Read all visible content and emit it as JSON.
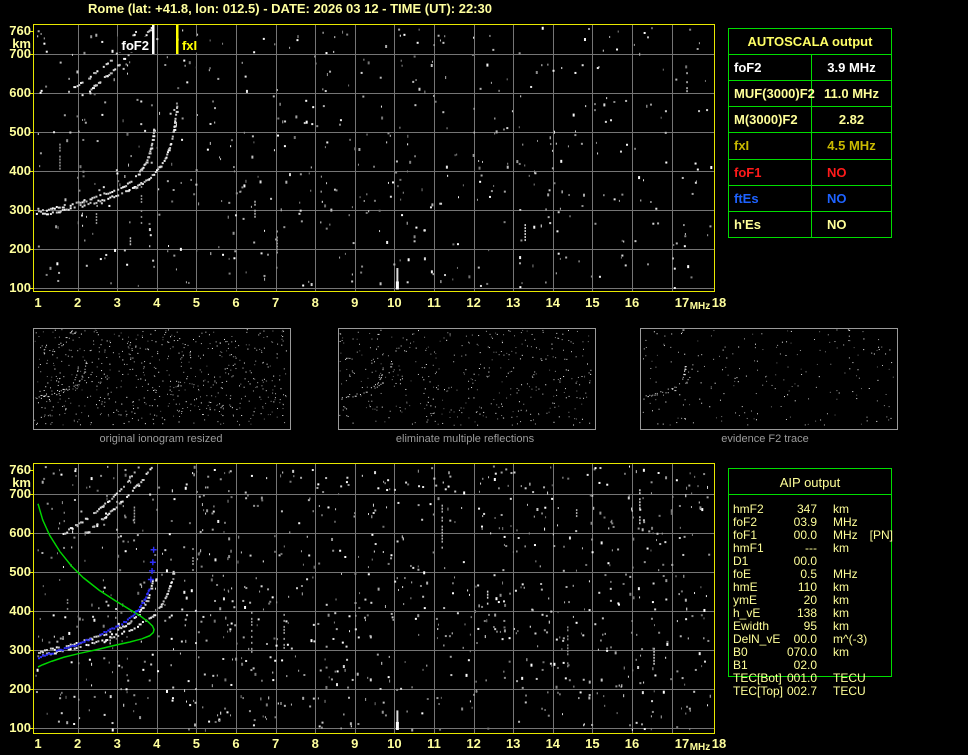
{
  "title": "Rome (lat: +41.8, lon: 012.5) - DATE: 2026 03 12 - TIME (UT): 22:30",
  "colors": {
    "background": "#000000",
    "axis_text": "#ffff9c",
    "plot_border": "#e8e800",
    "grid": "#757575",
    "table_border": "#00dd00",
    "trace_white": "#ffffff",
    "profile_green": "#00d400",
    "restored_blue": "#2e2eff",
    "caption_grey": "#9c9c9c"
  },
  "autoscala_table": {
    "header": "AUTOSCALA output",
    "rows": [
      {
        "label": "foF2",
        "value": "3.9 MHz",
        "color": "#ffffff"
      },
      {
        "label": "MUF(3000)F2",
        "value": "11.0 MHz",
        "color": "#ffff99"
      },
      {
        "label": "M(3000)F2",
        "value": "2.82",
        "color": "#ffff99"
      },
      {
        "label": "fxI",
        "value": "4.5 MHz",
        "color": "#c9b900"
      },
      {
        "label": "foF1",
        "value": "NO",
        "color": "#ff1a1a"
      },
      {
        "label": "ftEs",
        "value": "NO",
        "color": "#1e62ff"
      },
      {
        "label": "h'Es",
        "value": "NO",
        "color": "#ffff99"
      }
    ]
  },
  "aip_table": {
    "header": "AIP output",
    "rows": [
      {
        "label": "hmF2",
        "value": "347",
        "unit": "km",
        "extra": ""
      },
      {
        "label": "foF2",
        "value": "03.9",
        "unit": "MHz",
        "extra": ""
      },
      {
        "label": "foF1",
        "value": "00.0",
        "unit": "MHz",
        "extra": "[PN]"
      },
      {
        "label": "hmF1",
        "value": "---",
        "unit": "km",
        "extra": ""
      },
      {
        "label": "D1",
        "value": "00.0",
        "unit": "",
        "extra": ""
      },
      {
        "label": "foE",
        "value": "0.5",
        "unit": "MHz",
        "extra": ""
      },
      {
        "label": "hmE",
        "value": "110",
        "unit": "km",
        "extra": ""
      },
      {
        "label": "ymE",
        "value": "20",
        "unit": "km",
        "extra": ""
      },
      {
        "label": "h_vE",
        "value": "138",
        "unit": "km",
        "extra": ""
      },
      {
        "label": "Ewidth",
        "value": "95",
        "unit": "km",
        "extra": ""
      },
      {
        "label": "DelN_vE",
        "value": "00.0",
        "unit": "m^(-3)",
        "extra": ""
      },
      {
        "label": "B0",
        "value": "070.0",
        "unit": "km",
        "extra": ""
      },
      {
        "label": "B1",
        "value": "02.0",
        "unit": "",
        "extra": ""
      },
      {
        "label": "TEC[Bot]",
        "value": "001.0",
        "unit": "TECU",
        "extra": ""
      },
      {
        "label": "TEC[Top]",
        "value": "002.7",
        "unit": "TECU",
        "extra": ""
      }
    ]
  },
  "thumbnails": [
    {
      "caption": "original ionogram resized",
      "noise_dots": 640,
      "seed": 21,
      "show_second_hop": true
    },
    {
      "caption": "eliminate multiple reflections",
      "noise_dots": 430,
      "seed": 22,
      "show_second_hop": false
    },
    {
      "caption": "evidence F2 trace",
      "noise_dots": 210,
      "seed": 23,
      "show_second_hop": false
    }
  ],
  "chart_data": [
    {
      "id": "top-ionogram",
      "type": "scatter",
      "xlabel": "MHz",
      "ylabel": "km",
      "xlim": [
        1,
        18
      ],
      "ylim": [
        100,
        760
      ],
      "grid": true,
      "x_ticks": [
        "1",
        "2",
        "3",
        "4",
        "5",
        "6",
        "7",
        "8",
        "9",
        "10",
        "11",
        "12",
        "13",
        "14",
        "15",
        "16",
        "17",
        "18"
      ],
      "y_ticks": [
        "760",
        "700",
        "600",
        "500",
        "400",
        "300",
        "200",
        "100"
      ],
      "markers": [
        {
          "name": "foF2",
          "label": "foF2",
          "freq_mhz": 3.9,
          "color": "#ffffff"
        },
        {
          "name": "fxI",
          "label": "fxI",
          "freq_mhz": 4.5,
          "color": "#ffff00"
        }
      ],
      "traces": {
        "f2_ordinary": [
          [
            1.0,
            297
          ],
          [
            1.25,
            302
          ],
          [
            1.5,
            308
          ],
          [
            1.75,
            314
          ],
          [
            2.0,
            321
          ],
          [
            2.25,
            328
          ],
          [
            2.5,
            336
          ],
          [
            2.75,
            345
          ],
          [
            3.0,
            355
          ],
          [
            3.2,
            366
          ],
          [
            3.38,
            379
          ],
          [
            3.52,
            394
          ],
          [
            3.64,
            411
          ],
          [
            3.74,
            430
          ],
          [
            3.81,
            450
          ],
          [
            3.86,
            470
          ],
          [
            3.88,
            484
          ],
          [
            3.9,
            500
          ],
          [
            3.91,
            515
          ]
        ],
        "f2_extraordinary": [
          [
            1.1,
            290
          ],
          [
            1.4,
            296
          ],
          [
            1.7,
            303
          ],
          [
            2.0,
            310
          ],
          [
            2.3,
            318
          ],
          [
            2.6,
            327
          ],
          [
            2.9,
            337
          ],
          [
            3.2,
            349
          ],
          [
            3.5,
            363
          ],
          [
            3.75,
            379
          ],
          [
            3.95,
            397
          ],
          [
            4.1,
            417
          ],
          [
            4.22,
            439
          ],
          [
            4.31,
            462
          ],
          [
            4.37,
            484
          ],
          [
            4.41,
            505
          ],
          [
            4.44,
            528
          ],
          [
            4.47,
            550
          ],
          [
            4.5,
            572
          ]
        ],
        "second_hop_ordinary": [
          [
            1.62,
            600
          ],
          [
            1.85,
            614
          ],
          [
            2.1,
            630
          ],
          [
            2.35,
            648
          ],
          [
            2.6,
            668
          ],
          [
            2.85,
            690
          ],
          [
            3.08,
            712
          ],
          [
            3.28,
            736
          ],
          [
            3.45,
            758
          ],
          [
            3.55,
            772
          ]
        ],
        "second_hop_extraordinary": [
          [
            2.1,
            594
          ],
          [
            2.4,
            618
          ],
          [
            2.7,
            644
          ],
          [
            3.0,
            672
          ],
          [
            3.3,
            702
          ],
          [
            3.55,
            730
          ],
          [
            3.75,
            756
          ],
          [
            3.88,
            774
          ]
        ]
      },
      "noise": {
        "seed": 7,
        "dots": 560,
        "streaks": 9,
        "bright_streak": {
          "f": 10.05,
          "km_lo": 95,
          "km_hi": 150
        }
      }
    },
    {
      "id": "bottom-ionogram",
      "type": "scatter",
      "xlabel": "MHz",
      "ylabel": "km",
      "xlim": [
        1,
        18
      ],
      "ylim": [
        100,
        760
      ],
      "grid": true,
      "x_ticks": [
        "1",
        "2",
        "3",
        "4",
        "5",
        "6",
        "7",
        "8",
        "9",
        "10",
        "11",
        "12",
        "13",
        "14",
        "15",
        "16",
        "17",
        "18"
      ],
      "y_ticks": [
        "760",
        "700",
        "600",
        "500",
        "400",
        "300",
        "200",
        "100"
      ],
      "markers": [],
      "traces": {
        "f2_ordinary": [
          [
            1.0,
            297
          ],
          [
            1.25,
            302
          ],
          [
            1.5,
            308
          ],
          [
            1.75,
            314
          ],
          [
            2.0,
            321
          ],
          [
            2.25,
            328
          ],
          [
            2.5,
            336
          ],
          [
            2.75,
            345
          ],
          [
            3.0,
            355
          ],
          [
            3.2,
            366
          ],
          [
            3.38,
            379
          ],
          [
            3.52,
            394
          ],
          [
            3.64,
            411
          ],
          [
            3.74,
            430
          ],
          [
            3.81,
            450
          ],
          [
            3.86,
            470
          ],
          [
            3.88,
            484
          ]
        ],
        "f2_extraordinary": [
          [
            1.1,
            290
          ],
          [
            1.4,
            296
          ],
          [
            1.7,
            303
          ],
          [
            2.0,
            310
          ],
          [
            2.3,
            318
          ],
          [
            2.6,
            327
          ],
          [
            2.9,
            337
          ],
          [
            3.2,
            349
          ],
          [
            3.5,
            363
          ],
          [
            3.75,
            379
          ],
          [
            3.95,
            397
          ],
          [
            4.1,
            417
          ],
          [
            4.22,
            439
          ],
          [
            4.31,
            462
          ],
          [
            4.37,
            484
          ],
          [
            4.41,
            505
          ]
        ],
        "second_hop_ordinary": [
          [
            1.62,
            600
          ],
          [
            1.85,
            614
          ],
          [
            2.1,
            630
          ],
          [
            2.35,
            648
          ],
          [
            2.6,
            668
          ],
          [
            2.85,
            690
          ],
          [
            3.08,
            712
          ],
          [
            3.28,
            736
          ],
          [
            3.45,
            758
          ],
          [
            3.55,
            772
          ]
        ],
        "second_hop_extraordinary": [
          [
            2.1,
            594
          ],
          [
            2.4,
            618
          ],
          [
            2.7,
            644
          ],
          [
            3.0,
            672
          ],
          [
            3.3,
            702
          ],
          [
            3.55,
            730
          ],
          [
            3.75,
            756
          ],
          [
            3.88,
            774
          ]
        ]
      },
      "profile_green": [
        [
          1.0,
          674
        ],
        [
          1.12,
          632
        ],
        [
          1.3,
          592
        ],
        [
          1.55,
          552
        ],
        [
          1.85,
          514
        ],
        [
          2.15,
          484
        ],
        [
          2.55,
          452
        ],
        [
          2.95,
          426
        ],
        [
          3.3,
          404
        ],
        [
          3.58,
          387
        ],
        [
          3.78,
          372
        ],
        [
          3.89,
          361
        ],
        [
          3.93,
          352
        ],
        [
          3.91,
          344
        ],
        [
          3.82,
          336
        ],
        [
          3.62,
          328
        ],
        [
          3.32,
          320
        ],
        [
          2.92,
          311
        ],
        [
          2.5,
          301
        ],
        [
          2.05,
          291
        ],
        [
          1.65,
          281
        ],
        [
          1.35,
          271
        ],
        [
          1.12,
          262
        ],
        [
          1.0,
          256
        ]
      ],
      "restored_trace_blue": [
        [
          1.0,
          283
        ],
        [
          1.25,
          291
        ],
        [
          1.5,
          300
        ],
        [
          1.75,
          309
        ],
        [
          2.0,
          318
        ],
        [
          2.25,
          328
        ],
        [
          2.5,
          339
        ],
        [
          2.75,
          351
        ],
        [
          3.0,
          363
        ],
        [
          3.2,
          376
        ],
        [
          3.38,
          391
        ],
        [
          3.52,
          407
        ],
        [
          3.64,
          425
        ],
        [
          3.73,
          443
        ],
        [
          3.79,
          459
        ],
        [
          3.83,
          470
        ]
      ],
      "blue_plus_marks": [
        [
          3.85,
          480
        ],
        [
          3.88,
          502
        ],
        [
          3.9,
          524
        ],
        [
          3.92,
          556
        ]
      ],
      "noise": {
        "seed": 41,
        "dots": 1020,
        "streaks": 12,
        "bright_streak": {
          "f": 10.05,
          "km_lo": 95,
          "km_hi": 145
        }
      }
    }
  ]
}
